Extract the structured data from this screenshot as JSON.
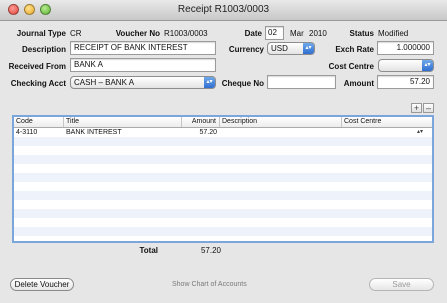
{
  "window": {
    "title": "Receipt R1003/0003"
  },
  "header": {
    "journal_type_label": "Journal Type",
    "journal_type_value": "CR",
    "voucher_no_label": "Voucher No",
    "voucher_no_value": "R1003/0003",
    "date_label": "Date",
    "date_day": "02",
    "date_month": "Mar",
    "date_year": "2010",
    "status_label": "Status",
    "status_value": "Modified",
    "description_label": "Description",
    "description_value": "RECEIPT OF BANK INTEREST",
    "currency_label": "Currency",
    "currency_value": "USD",
    "exch_rate_label": "Exch Rate",
    "exch_rate_value": "1.000000",
    "received_from_label": "Received From",
    "received_from_value": "BANK A",
    "cost_centre_label": "Cost Centre",
    "cost_centre_value": "",
    "checking_acct_label": "Checking Acct",
    "checking_acct_value": "CASH – BANK A",
    "cheque_no_label": "Cheque No",
    "cheque_no_value": "",
    "amount_label": "Amount",
    "amount_value": "57.20"
  },
  "grid": {
    "add_label": "+",
    "remove_label": "–",
    "columns": [
      "Code",
      "Title",
      "Amount",
      "Description",
      "Cost Centre"
    ],
    "rows": [
      {
        "code": "4-3110",
        "title": "BANK INTEREST",
        "amount": "57.20",
        "description": "",
        "cost_centre": ""
      }
    ]
  },
  "footer": {
    "total_label": "Total",
    "total_value": "57.20",
    "delete_label": "Delete Voucher",
    "chart_label": "Show Chart of Accounts",
    "save_label": "Save"
  },
  "icons": {
    "popup_arrow": "up-down-arrows-icon"
  },
  "colors": {
    "accent": "#3a7bd5",
    "grid_border": "#7aa6dc"
  }
}
